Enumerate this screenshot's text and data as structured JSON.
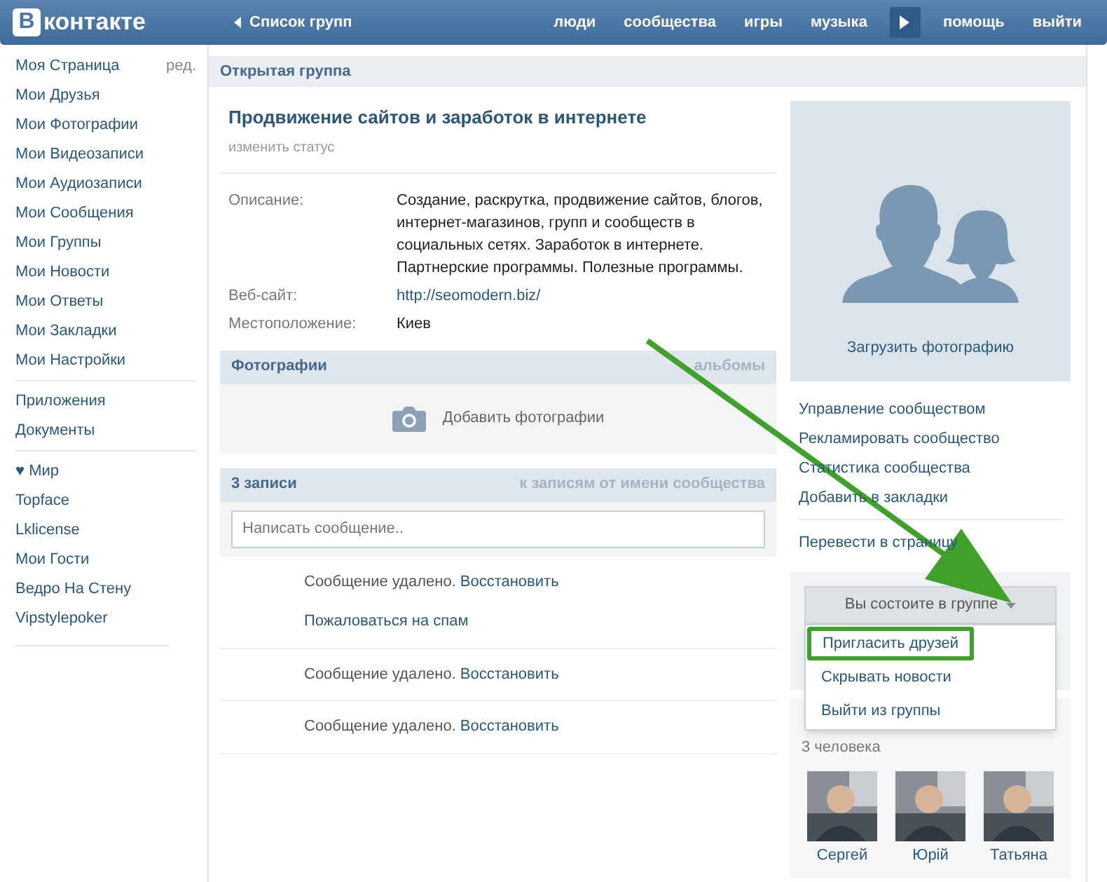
{
  "header": {
    "logo_letter": "В",
    "logo_text": "контакте",
    "back_link": "Список групп",
    "nav": [
      {
        "kind": "link",
        "label": "люди"
      },
      {
        "kind": "link",
        "label": "сообщества"
      },
      {
        "kind": "link",
        "label": "игры"
      },
      {
        "kind": "link",
        "label": "музыка"
      },
      {
        "kind": "player"
      },
      {
        "kind": "link",
        "label": "помощь"
      },
      {
        "kind": "link",
        "label": "выйти"
      }
    ]
  },
  "sidebar": {
    "edit_link": "ред.",
    "sections": [
      [
        "Моя Страница",
        "Мои Друзья",
        "Мои Фотографии",
        "Мои Видеозаписи",
        "Мои Аудиозаписи",
        "Мои Сообщения",
        "Мои Группы",
        "Мои Новости",
        "Мои Ответы",
        "Мои Закладки",
        "Мои Настройки"
      ],
      [
        "Приложения",
        "Документы"
      ],
      [
        "♥ Мир",
        "Topface",
        "Lklicense",
        "Мои Гости",
        "Ведро На Стену",
        "Vipstylepoker"
      ]
    ]
  },
  "group": {
    "section_title": "Открытая группа",
    "name": "Продвижение сайтов и заработок в интернете",
    "status_link": "изменить статус",
    "info": [
      {
        "kind": "text",
        "label": "Описание:",
        "value": "Создание, раскрутка, продвижение сайтов, блогов, интернет-магазинов, групп и сообществ в социальных сетях. Заработок в интернете. Партнерские программы. Полезные программы."
      },
      {
        "kind": "link",
        "label": "Веб-сайт:",
        "value": "http://seomodern.biz/"
      },
      {
        "kind": "text",
        "label": "Местоположение:",
        "value": "Киев"
      }
    ],
    "photos": {
      "title": "Фотографии",
      "link": "альбомы",
      "add": "Добавить фотографии"
    },
    "wall": {
      "title": "3 записи",
      "link": "к записям от имени сообщества",
      "placeholder": "Написать сообщение..",
      "posts": [
        {
          "text": "Сообщение удалено.",
          "restore": "Восстановить",
          "spam": "Пожаловаться на спам"
        },
        {
          "text": "Сообщение удалено.",
          "restore": "Восстановить"
        },
        {
          "text": "Сообщение удалено.",
          "restore": "Восстановить"
        }
      ]
    }
  },
  "right": {
    "upload": "Загрузить фотографию",
    "actions": [
      [
        "Управление сообществом",
        "Рекламировать сообщество",
        "Статистика сообщества",
        "Добавить в закладки"
      ],
      [
        "Перевести в страницу"
      ]
    ],
    "membership": {
      "button": "Вы состоите в группе",
      "expanded": true,
      "menu": [
        {
          "label": "Пригласить друзей",
          "highlighted": true
        },
        {
          "label": "Скрывать новости",
          "highlighted": false
        },
        {
          "label": "Выйти из группы",
          "highlighted": false
        }
      ]
    },
    "members": {
      "count": "3 человека",
      "people": [
        {
          "name": "Сергей"
        },
        {
          "name": "Юрій"
        },
        {
          "name": "Татьяна"
        }
      ]
    }
  }
}
